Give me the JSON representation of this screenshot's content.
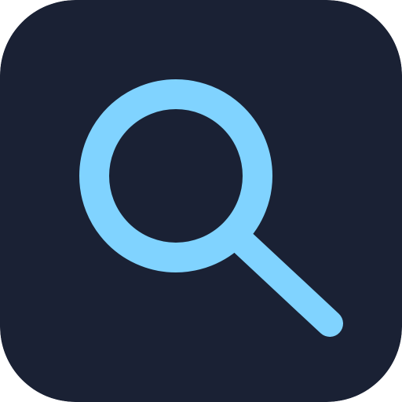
{
  "app_icon": {
    "icon": "search-icon",
    "background_color": "#1a2134",
    "glyph_color": "#80d3ff"
  }
}
